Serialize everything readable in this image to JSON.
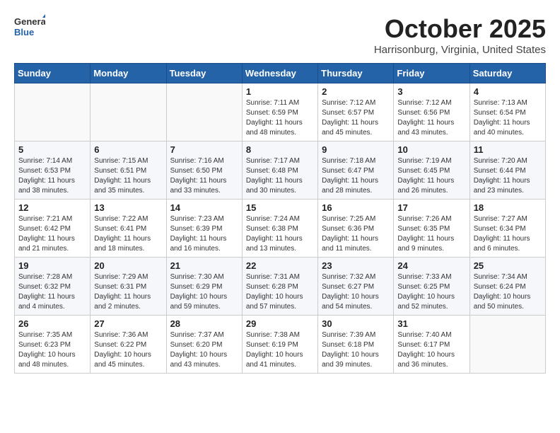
{
  "header": {
    "logo": {
      "line1": "General",
      "line2": "Blue"
    },
    "month": "October 2025",
    "location": "Harrisonburg, Virginia, United States"
  },
  "weekdays": [
    "Sunday",
    "Monday",
    "Tuesday",
    "Wednesday",
    "Thursday",
    "Friday",
    "Saturday"
  ],
  "weeks": [
    [
      {
        "day": "",
        "info": ""
      },
      {
        "day": "",
        "info": ""
      },
      {
        "day": "",
        "info": ""
      },
      {
        "day": "1",
        "info": "Sunrise: 7:11 AM\nSunset: 6:59 PM\nDaylight: 11 hours\nand 48 minutes."
      },
      {
        "day": "2",
        "info": "Sunrise: 7:12 AM\nSunset: 6:57 PM\nDaylight: 11 hours\nand 45 minutes."
      },
      {
        "day": "3",
        "info": "Sunrise: 7:12 AM\nSunset: 6:56 PM\nDaylight: 11 hours\nand 43 minutes."
      },
      {
        "day": "4",
        "info": "Sunrise: 7:13 AM\nSunset: 6:54 PM\nDaylight: 11 hours\nand 40 minutes."
      }
    ],
    [
      {
        "day": "5",
        "info": "Sunrise: 7:14 AM\nSunset: 6:53 PM\nDaylight: 11 hours\nand 38 minutes."
      },
      {
        "day": "6",
        "info": "Sunrise: 7:15 AM\nSunset: 6:51 PM\nDaylight: 11 hours\nand 35 minutes."
      },
      {
        "day": "7",
        "info": "Sunrise: 7:16 AM\nSunset: 6:50 PM\nDaylight: 11 hours\nand 33 minutes."
      },
      {
        "day": "8",
        "info": "Sunrise: 7:17 AM\nSunset: 6:48 PM\nDaylight: 11 hours\nand 30 minutes."
      },
      {
        "day": "9",
        "info": "Sunrise: 7:18 AM\nSunset: 6:47 PM\nDaylight: 11 hours\nand 28 minutes."
      },
      {
        "day": "10",
        "info": "Sunrise: 7:19 AM\nSunset: 6:45 PM\nDaylight: 11 hours\nand 26 minutes."
      },
      {
        "day": "11",
        "info": "Sunrise: 7:20 AM\nSunset: 6:44 PM\nDaylight: 11 hours\nand 23 minutes."
      }
    ],
    [
      {
        "day": "12",
        "info": "Sunrise: 7:21 AM\nSunset: 6:42 PM\nDaylight: 11 hours\nand 21 minutes."
      },
      {
        "day": "13",
        "info": "Sunrise: 7:22 AM\nSunset: 6:41 PM\nDaylight: 11 hours\nand 18 minutes."
      },
      {
        "day": "14",
        "info": "Sunrise: 7:23 AM\nSunset: 6:39 PM\nDaylight: 11 hours\nand 16 minutes."
      },
      {
        "day": "15",
        "info": "Sunrise: 7:24 AM\nSunset: 6:38 PM\nDaylight: 11 hours\nand 13 minutes."
      },
      {
        "day": "16",
        "info": "Sunrise: 7:25 AM\nSunset: 6:36 PM\nDaylight: 11 hours\nand 11 minutes."
      },
      {
        "day": "17",
        "info": "Sunrise: 7:26 AM\nSunset: 6:35 PM\nDaylight: 11 hours\nand 9 minutes."
      },
      {
        "day": "18",
        "info": "Sunrise: 7:27 AM\nSunset: 6:34 PM\nDaylight: 11 hours\nand 6 minutes."
      }
    ],
    [
      {
        "day": "19",
        "info": "Sunrise: 7:28 AM\nSunset: 6:32 PM\nDaylight: 11 hours\nand 4 minutes."
      },
      {
        "day": "20",
        "info": "Sunrise: 7:29 AM\nSunset: 6:31 PM\nDaylight: 11 hours\nand 2 minutes."
      },
      {
        "day": "21",
        "info": "Sunrise: 7:30 AM\nSunset: 6:29 PM\nDaylight: 10 hours\nand 59 minutes."
      },
      {
        "day": "22",
        "info": "Sunrise: 7:31 AM\nSunset: 6:28 PM\nDaylight: 10 hours\nand 57 minutes."
      },
      {
        "day": "23",
        "info": "Sunrise: 7:32 AM\nSunset: 6:27 PM\nDaylight: 10 hours\nand 54 minutes."
      },
      {
        "day": "24",
        "info": "Sunrise: 7:33 AM\nSunset: 6:25 PM\nDaylight: 10 hours\nand 52 minutes."
      },
      {
        "day": "25",
        "info": "Sunrise: 7:34 AM\nSunset: 6:24 PM\nDaylight: 10 hours\nand 50 minutes."
      }
    ],
    [
      {
        "day": "26",
        "info": "Sunrise: 7:35 AM\nSunset: 6:23 PM\nDaylight: 10 hours\nand 48 minutes."
      },
      {
        "day": "27",
        "info": "Sunrise: 7:36 AM\nSunset: 6:22 PM\nDaylight: 10 hours\nand 45 minutes."
      },
      {
        "day": "28",
        "info": "Sunrise: 7:37 AM\nSunset: 6:20 PM\nDaylight: 10 hours\nand 43 minutes."
      },
      {
        "day": "29",
        "info": "Sunrise: 7:38 AM\nSunset: 6:19 PM\nDaylight: 10 hours\nand 41 minutes."
      },
      {
        "day": "30",
        "info": "Sunrise: 7:39 AM\nSunset: 6:18 PM\nDaylight: 10 hours\nand 39 minutes."
      },
      {
        "day": "31",
        "info": "Sunrise: 7:40 AM\nSunset: 6:17 PM\nDaylight: 10 hours\nand 36 minutes."
      },
      {
        "day": "",
        "info": ""
      }
    ]
  ]
}
